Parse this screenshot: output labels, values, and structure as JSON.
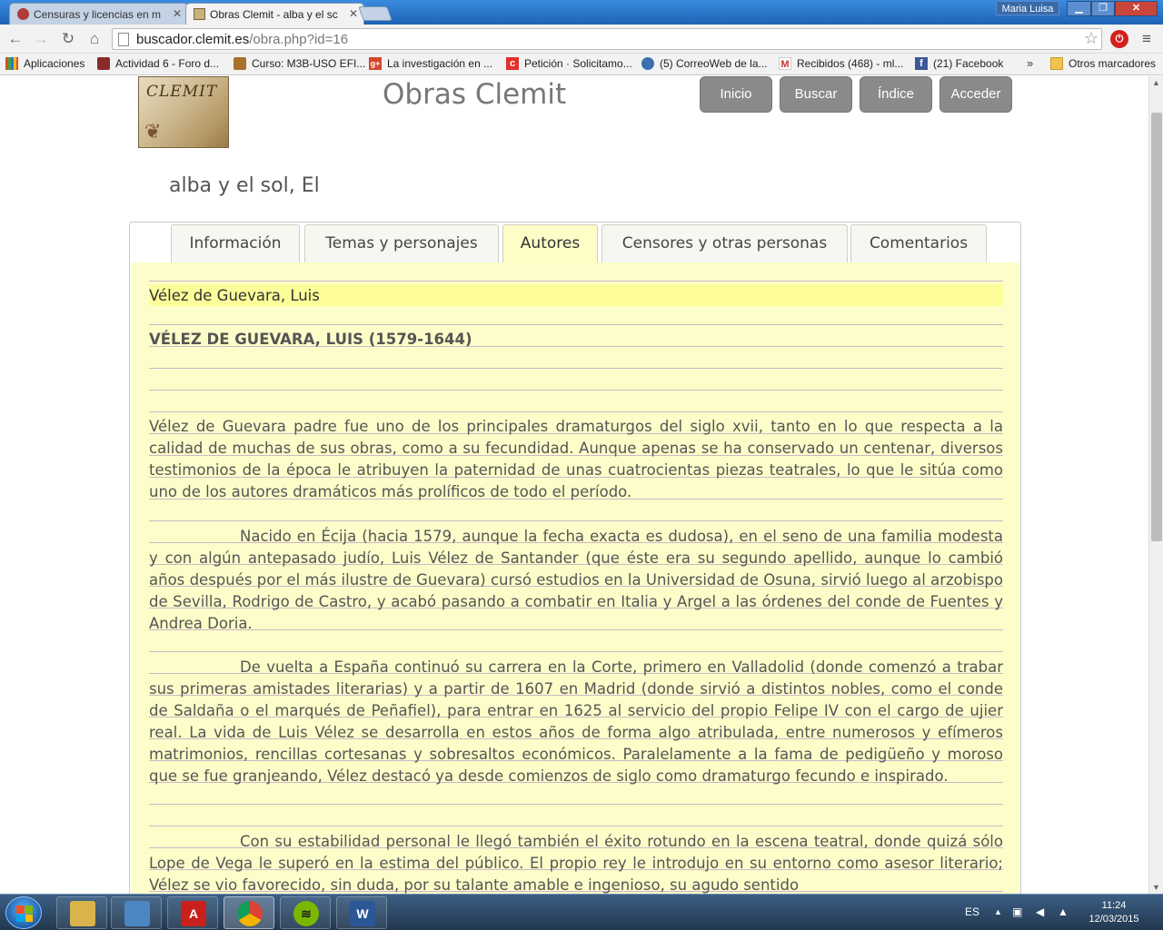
{
  "browser": {
    "tabs": [
      {
        "title": "Censuras y licencias en m",
        "active": false
      },
      {
        "title": "Obras Clemit - alba y el sc",
        "active": true
      }
    ],
    "window_user": "Maria Luisa",
    "url_host": "buscador.clemit.es",
    "url_path": "/obra.php?id=16",
    "bookmarks": [
      {
        "label": "Aplicaciones",
        "icon": "apps-grid-icon"
      },
      {
        "label": "Actividad 6 - Foro d...",
        "icon": "moodle-icon"
      },
      {
        "label": "Curso: M3B-USO EFI...",
        "icon": "moodle-icon"
      },
      {
        "label": "La investigación en ...",
        "icon": "google-plus-icon"
      },
      {
        "label": "Petición · Solicitamo...",
        "icon": "change-org-icon"
      },
      {
        "label": "(5) CorreoWeb de la...",
        "icon": "mail-icon"
      },
      {
        "label": "Recibidos (468) - ml...",
        "icon": "gmail-icon"
      },
      {
        "label": "(21) Facebook",
        "icon": "facebook-icon"
      }
    ],
    "bookmarks_more": "»",
    "other_bookmarks": "Otros marcadores"
  },
  "site": {
    "logo_text": "CLEMIT",
    "title": "Obras Clemit",
    "nav": [
      "Inicio",
      "Buscar",
      "Índice",
      "Acceder"
    ]
  },
  "page": {
    "title": "alba y el sol, El",
    "tabs": [
      "Información",
      "Temas y personajes",
      "Autores",
      "Censores y otras personas",
      "Comentarios"
    ],
    "active_tab": "Autores",
    "author_name": "Vélez de Guevara, Luis",
    "author_heading": "VÉLEZ DE GUEVARA, LUIS (1579-1644)",
    "paragraphs": [
      "Vélez de Guevara padre fue uno de los principales dramaturgos del siglo xvii, tanto en lo que respecta a la calidad de muchas de sus obras, como a su fecundidad. Aunque apenas se ha conservado un centenar, diversos testimonios de la época le atribuyen la paternidad de unas cuatrocientas piezas teatrales, lo que le sitúa como uno de los autores dramáticos más prolíficos de todo el período.",
      "Nacido en Écija (hacia 1579, aunque la fecha exacta es dudosa), en el seno de una familia modesta y con algún antepasado judío, Luis Vélez de Santander (que éste era su segundo apellido, aunque lo cambió años después por el más ilustre de Guevara) cursó estudios en la Universidad de Osuna, sirvió luego al arzobispo de Sevilla, Rodrigo de Castro, y acabó pasando a combatir en Italia y Argel a las órdenes del conde de Fuentes y Andrea Doria.",
      "De vuelta a España continuó su carrera en la Corte, primero en Valladolid (donde comenzó a trabar sus primeras amistades literarias) y a partir de 1607 en Madrid (donde sirvió a distintos nobles, como el conde de Saldaña o el marqués de Peñafiel), para entrar en 1625 al servicio del propio Felipe IV con el cargo de ujier real. La vida de Luis Vélez se desarrolla en estos años de forma algo atribulada, entre numerosos y efímeros matrimonios, rencillas cortesanas y sobresaltos económicos. Paralelamente a la fama de pedigüeño y moroso que se fue granjeando, Vélez destacó ya desde comienzos de siglo como dramaturgo fecundo e inspirado.",
      "Con su estabilidad personal le llegó también el éxito rotundo en la escena teatral, donde quizá sólo Lope de Vega le superó en la estima del público. El propio rey le introdujo en su entorno como asesor literario; Vélez se vio favorecido, sin duda, por su talante amable e ingenioso, su agudo sentido"
    ]
  },
  "taskbar": {
    "apps": [
      {
        "name": "explorer-icon",
        "color": "#d9b44a"
      },
      {
        "name": "photo-viewer-icon",
        "color": "#4c87c4"
      },
      {
        "name": "acrobat-icon",
        "color": "#c8201a"
      },
      {
        "name": "chrome-icon",
        "color": "#3f9b46"
      },
      {
        "name": "spotify-icon",
        "color": "#7ab800"
      },
      {
        "name": "word-icon",
        "color": "#2b5797"
      }
    ],
    "lang": "ES",
    "time": "11:24",
    "date": "12/03/2015"
  }
}
